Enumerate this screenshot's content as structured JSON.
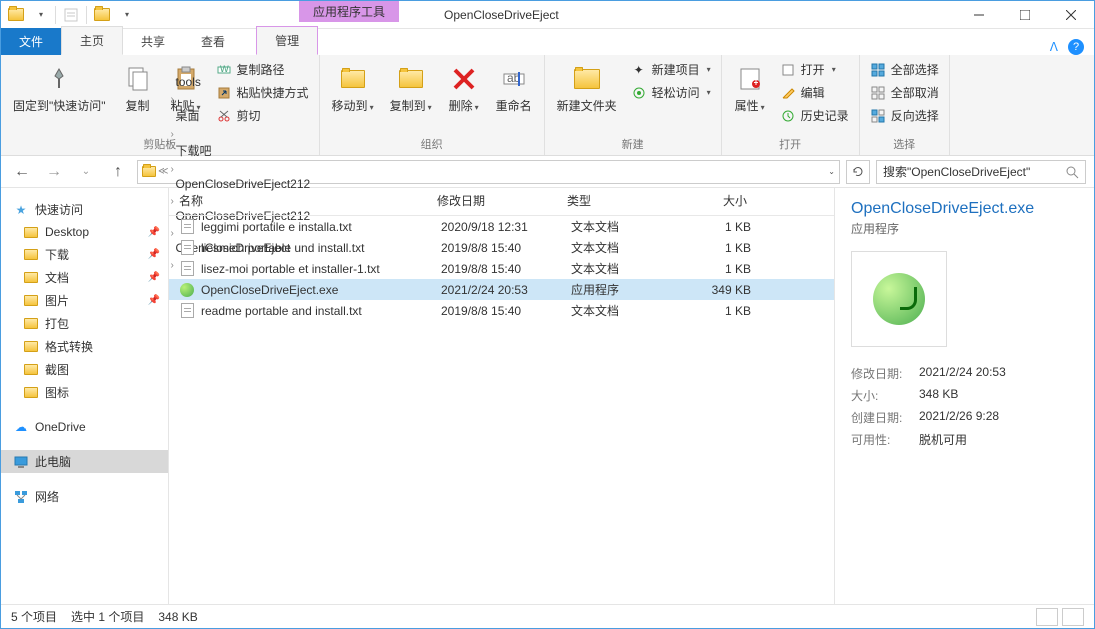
{
  "window": {
    "context_tab": "应用程序工具",
    "title": "OpenCloseDriveEject"
  },
  "tabs": {
    "file": "文件",
    "home": "主页",
    "share": "共享",
    "view": "查看",
    "manage": "管理"
  },
  "ribbon": {
    "pin_quick": "固定到\"快速访问\"",
    "copy": "复制",
    "paste": "粘贴",
    "cut": "剪切",
    "copy_path": "复制路径",
    "paste_shortcut": "粘贴快捷方式",
    "group_clipboard": "剪贴板",
    "move_to": "移动到",
    "copy_to": "复制到",
    "delete": "删除",
    "rename": "重命名",
    "group_organize": "组织",
    "new_folder": "新建文件夹",
    "new_item": "新建项目",
    "easy_access": "轻松访问",
    "group_new": "新建",
    "properties": "属性",
    "open": "打开",
    "edit": "编辑",
    "history": "历史记录",
    "group_open": "打开",
    "select_all": "全部选择",
    "select_none": "全部取消",
    "invert_selection": "反向选择",
    "group_select": "选择"
  },
  "breadcrumb": [
    "tools",
    "桌面",
    "下载吧",
    "OpenCloseDriveEject212",
    "OpenCloseDriveEject212",
    "OpenCloseDriveEject"
  ],
  "search_placeholder": "搜索\"OpenCloseDriveEject\"",
  "sidebar": {
    "quick_access": "快速访问",
    "items": [
      "Desktop",
      "下载",
      "文档",
      "图片",
      "打包",
      "格式转换",
      "截图",
      "图标"
    ],
    "onedrive": "OneDrive",
    "this_pc": "此电脑",
    "network": "网络"
  },
  "columns": {
    "name": "名称",
    "date": "修改日期",
    "type": "类型",
    "size": "大小"
  },
  "files": [
    {
      "ico": "txt",
      "name": "leggimi portatile e installa.txt",
      "date": "2020/9/18 12:31",
      "type": "文本文档",
      "size": "1 KB"
    },
    {
      "ico": "txt",
      "name": "liesmich portable und install.txt",
      "date": "2019/8/8 15:40",
      "type": "文本文档",
      "size": "1 KB"
    },
    {
      "ico": "txt",
      "name": "lisez-moi portable et installer-1.txt",
      "date": "2019/8/8 15:40",
      "type": "文本文档",
      "size": "1 KB"
    },
    {
      "ico": "exe",
      "name": "OpenCloseDriveEject.exe",
      "date": "2021/2/24 20:53",
      "type": "应用程序",
      "size": "349 KB",
      "selected": true
    },
    {
      "ico": "txt",
      "name": "readme portable and install.txt",
      "date": "2019/8/8 15:40",
      "type": "文本文档",
      "size": "1 KB"
    }
  ],
  "details": {
    "title": "OpenCloseDriveEject.exe",
    "type": "应用程序",
    "rows": [
      {
        "k": "修改日期:",
        "v": "2021/2/24 20:53"
      },
      {
        "k": "大小:",
        "v": "348 KB"
      },
      {
        "k": "创建日期:",
        "v": "2021/2/26 9:28"
      },
      {
        "k": "可用性:",
        "v": "脱机可用"
      }
    ]
  },
  "status": {
    "count": "5 个项目",
    "selection": "选中 1 个项目",
    "size": "348 KB"
  }
}
